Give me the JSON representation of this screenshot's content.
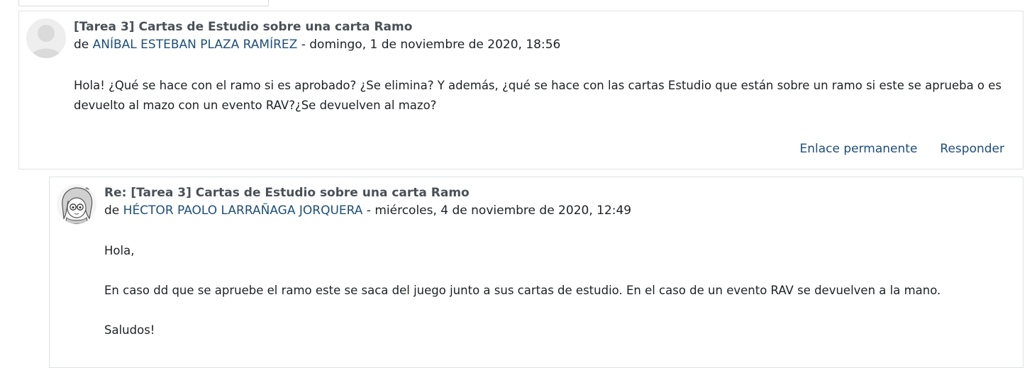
{
  "posts": [
    {
      "subject": "[Tarea 3] Cartas de Estudio sobre una carta Ramo",
      "by_prefix": "de ",
      "author": "ANÍBAL ESTEBAN PLAZA RAMÍREZ",
      "date": " - domingo, 1 de noviembre de 2020, 18:56",
      "body": [
        "Hola! ¿Qué se hace con el ramo si es aprobado? ¿Se elimina? Y además, ¿qué se hace con las cartas Estudio que están sobre un ramo si este se aprueba o es devuelto al mazo con un evento RAV?¿Se devuelven al mazo?"
      ],
      "actions": {
        "permalink": "Enlace permanente",
        "reply": "Responder"
      }
    },
    {
      "subject": "Re: [Tarea 3] Cartas de Estudio sobre una carta Ramo",
      "by_prefix": "de ",
      "author": "HÉCTOR PAOLO LARRAÑAGA JORQUERA",
      "date": " - miércoles, 4 de noviembre de 2020, 12:49",
      "body": [
        "Hola,",
        "En caso dd que se apruebe el ramo este se saca del juego junto a sus cartas de estudio. En el caso de un evento RAV se devuelven a la mano.",
        "Saludos!"
      ]
    }
  ]
}
